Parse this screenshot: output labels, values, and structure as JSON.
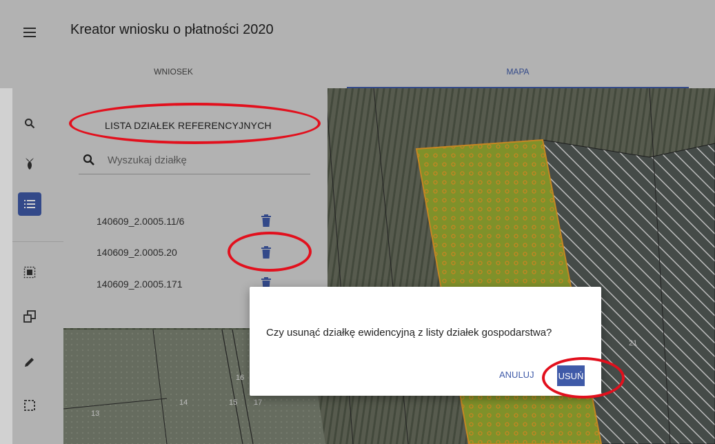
{
  "app": {
    "title": "Kreator wniosku o płatności 2020"
  },
  "tabs": [
    {
      "label": "WNIOSEK",
      "active": false
    },
    {
      "label": "MAPA",
      "active": true
    }
  ],
  "sidebar": {
    "items": [
      {
        "icon": "search-icon"
      },
      {
        "icon": "plant-icon"
      },
      {
        "icon": "list-icon",
        "active": true
      },
      {
        "icon": "select-area-icon"
      },
      {
        "icon": "copy-icon"
      },
      {
        "icon": "pencil-icon"
      },
      {
        "icon": "dashed-rectangle-icon"
      }
    ]
  },
  "panel": {
    "title": "LISTA DZIAŁEK REFERENCYJNYCH",
    "search": {
      "placeholder": "Wyszukaj działkę",
      "value": ""
    },
    "parcels": [
      {
        "id": "140609_2.0005.11/6"
      },
      {
        "id": "140609_2.0005.20"
      },
      {
        "id": "140609_2.0005.171"
      }
    ]
  },
  "map": {
    "labels": [
      "13",
      "14",
      "15",
      "16",
      "17",
      "21"
    ]
  },
  "dialog": {
    "message": "Czy usunąć działkę ewidencyjną z listy działek gospodarstwa?",
    "cancel_label": "ANULUJ",
    "confirm_label": "USUŃ"
  },
  "colors": {
    "accent": "#3f5aa8",
    "callout": "#e2101d",
    "parcel_fill": "#9bb134",
    "parcel_border": "#f2a52a"
  }
}
